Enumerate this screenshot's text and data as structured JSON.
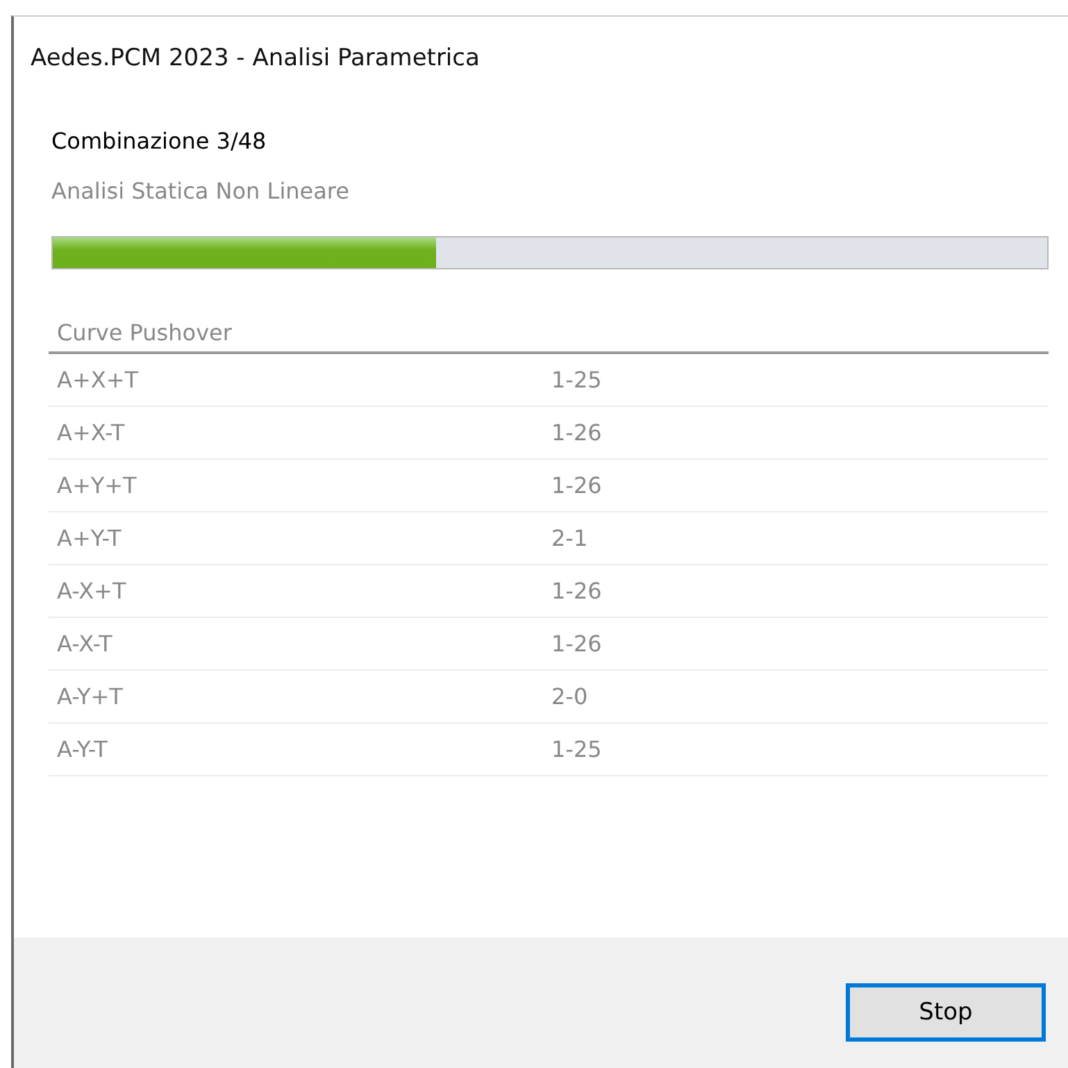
{
  "window": {
    "title": "Aedes.PCM 2023 - Analisi Parametrica"
  },
  "combination": "Combinazione 3/48",
  "analysis": "Analisi Statica Non Lineare",
  "progress": {
    "level": 0.385
  },
  "table": {
    "columns": [
      "Curve Pushover"
    ],
    "rows": [
      {
        "name": "A+X+T",
        "value": "1-25"
      },
      {
        "name": "A+X-T",
        "value": "1-26"
      },
      {
        "name": "A+Y+T",
        "value": "1-26"
      },
      {
        "name": "A+Y-T",
        "value": "2-1"
      },
      {
        "name": "A-X+T",
        "value": "1-26"
      },
      {
        "name": "A-X-T",
        "value": "1-26"
      },
      {
        "name": "A-Y+T",
        "value": "2-0"
      },
      {
        "name": "A-Y-T",
        "value": "1-25"
      }
    ]
  },
  "buttons": [
    {
      "label": "Stop",
      "selected": true
    }
  ]
}
